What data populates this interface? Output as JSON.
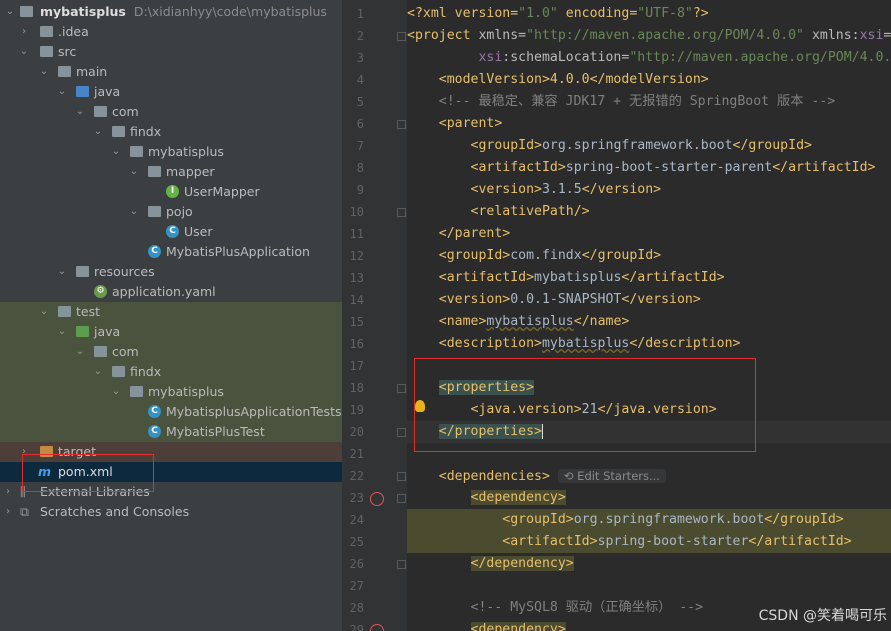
{
  "tree": {
    "project_name": "mybatisplus",
    "project_path": "D:\\xidianhyy\\code\\mybatisplus",
    "items": [
      "mybatisplus",
      ".idea",
      "src",
      "main",
      "java",
      "com",
      "findx",
      "mybatisplus",
      "mapper",
      "UserMapper",
      "pojo",
      "User",
      "MybatisPlusApplication",
      "resources",
      "application.yaml",
      "test",
      "java",
      "com",
      "findx",
      "mybatisplus",
      "MybatisplusApplicationTests",
      "MybatisPlusTest",
      "target",
      "pom.xml",
      "External Libraries",
      "Scratches and Consoles"
    ]
  },
  "editor": {
    "line_numbers": [
      "1",
      "2",
      "3",
      "4",
      "5",
      "6",
      "7",
      "8",
      "9",
      "10",
      "11",
      "12",
      "13",
      "14",
      "15",
      "16",
      "17",
      "18",
      "19",
      "20",
      "21",
      "22",
      "23",
      "24",
      "25",
      "26",
      "27",
      "28",
      "29"
    ],
    "edit_starters": "Edit Starters...",
    "lines": {
      "l1a": "<?xml version=",
      "l1b": "\"1.0\"",
      "l1c": " encoding=",
      "l1d": "\"UTF-8\"",
      "l1e": "?>",
      "l2a": "<project",
      "l2b": " xmlns=",
      "l2c": "\"http://maven.apache.org/POM/4.0.0\"",
      "l2d": " xmlns:",
      "l2e": "xsi",
      "l2f": "=",
      "l3a": "         xsi",
      "l3b": ":schemaLocation=",
      "l3c": "\"http://maven.apache.org/POM/4.0.",
      "l4": "    <modelVersion>4.0.0</modelVersion>",
      "l5": "    <!-- 最稳定、兼容 JDK17 + 无报错的 SpringBoot 版本 -->",
      "l6": "    <parent>",
      "l7a": "        <groupId>",
      "l7b": "org.springframework.boot",
      "l7c": "</groupId>",
      "l8a": "        <artifactId>",
      "l8b": "spring-boot-starter-parent",
      "l8c": "</artifactId>",
      "l9a": "        <version>",
      "l9b": "3.1.5",
      "l9c": "</version>",
      "l10": "        <relativePath/>",
      "l11": "    </parent>",
      "l12a": "    <groupId>",
      "l12b": "com.findx",
      "l12c": "</groupId>",
      "l13a": "    <artifactId>",
      "l13b": "mybatisplus",
      "l13c": "</artifactId>",
      "l14a": "    <version>",
      "l14b": "0.0.1-SNAPSHOT",
      "l14c": "</version>",
      "l15a": "    <name>",
      "l15b": "mybatisplus",
      "l15c": "</name>",
      "l16a": "    <description>",
      "l16b": "mybatisplus",
      "l16c": "</description>",
      "l18": "<properties>",
      "l19a": "        <java.version>",
      "l19b": "21",
      "l19c": "</java.version>",
      "l20": "</properties>",
      "l22": "<dependencies>",
      "l23": "<dependency>",
      "l24a": "            <groupId>",
      "l24b": "org.springframework.boot",
      "l24c": "</groupId>",
      "l25a": "            <artifactId>",
      "l25b": "spring-boot-starter",
      "l25c": "</artifactId>",
      "l26": "</dependency>",
      "l28": "        <!-- MySQL8 驱动（正确坐标） -->",
      "l29": "<dependency>"
    }
  },
  "watermark": "CSDN @笑着喝可乐",
  "colors": {
    "tag": "#e8bf6a",
    "string": "#6a8759",
    "comment": "#808080",
    "highlight_box": "#e0302d"
  }
}
